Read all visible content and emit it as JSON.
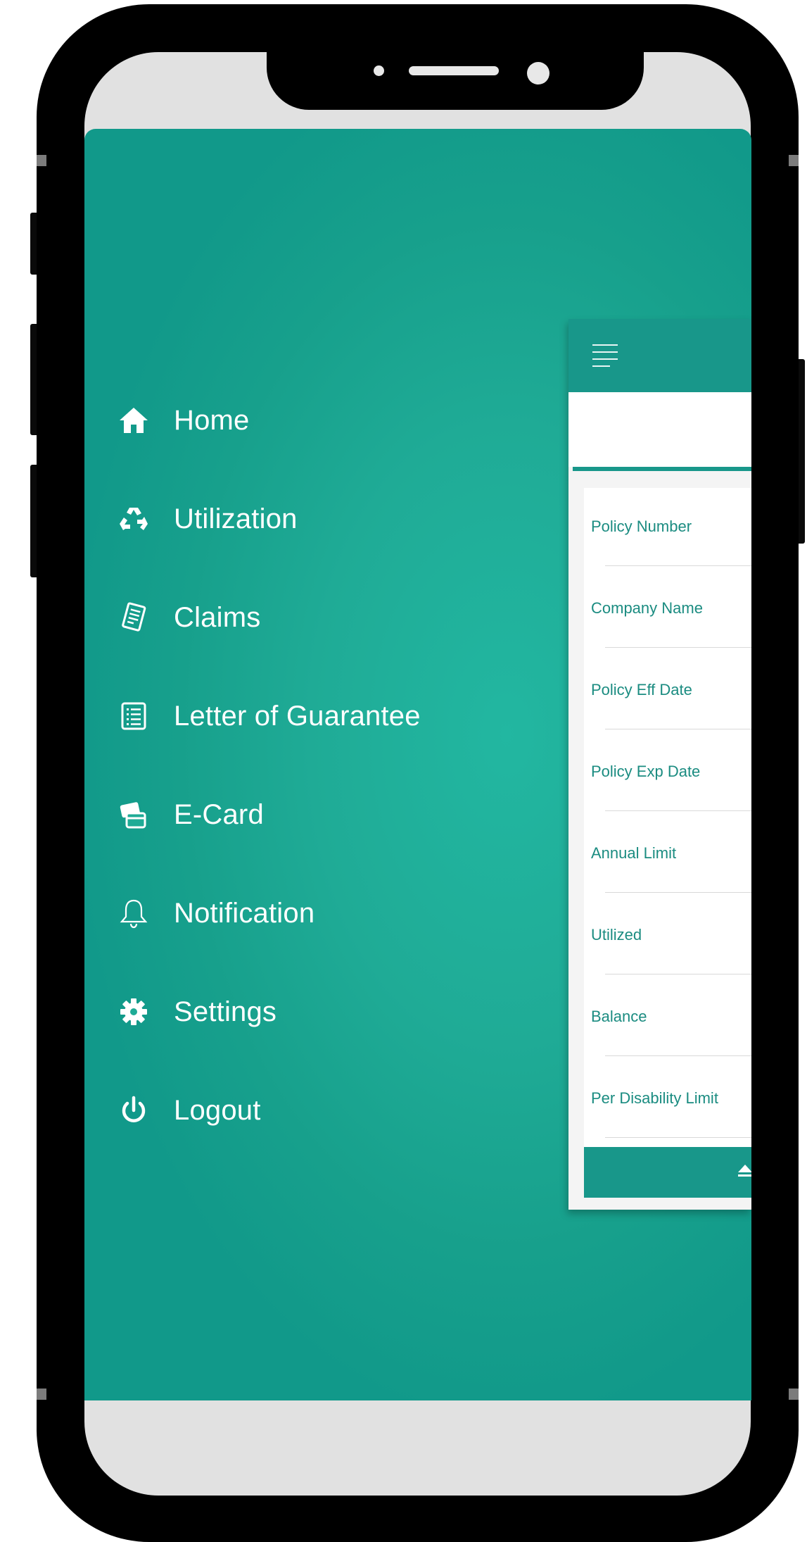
{
  "menu": {
    "items": [
      {
        "label": "Home",
        "icon": "home-icon"
      },
      {
        "label": "Utilization",
        "icon": "recycle-icon"
      },
      {
        "label": "Claims",
        "icon": "receipt-icon"
      },
      {
        "label": "Letter of Guarantee",
        "icon": "document-list-icon"
      },
      {
        "label": "E-Card",
        "icon": "card-icon"
      },
      {
        "label": "Notification",
        "icon": "bell-icon"
      },
      {
        "label": "Settings",
        "icon": "gear-icon"
      },
      {
        "label": "Logout",
        "icon": "power-icon"
      }
    ]
  },
  "policy": {
    "fields": [
      {
        "label": "Policy Number"
      },
      {
        "label": "Company Name"
      },
      {
        "label": "Policy Eff Date"
      },
      {
        "label": "Policy Exp Date"
      },
      {
        "label": "Annual Limit"
      },
      {
        "label": "Utilized"
      },
      {
        "label": "Balance"
      },
      {
        "label": "Per Disability Limit"
      }
    ]
  },
  "colors": {
    "accent": "#18978a",
    "drawer": "#1fab96",
    "field_label": "#1b8c81"
  }
}
